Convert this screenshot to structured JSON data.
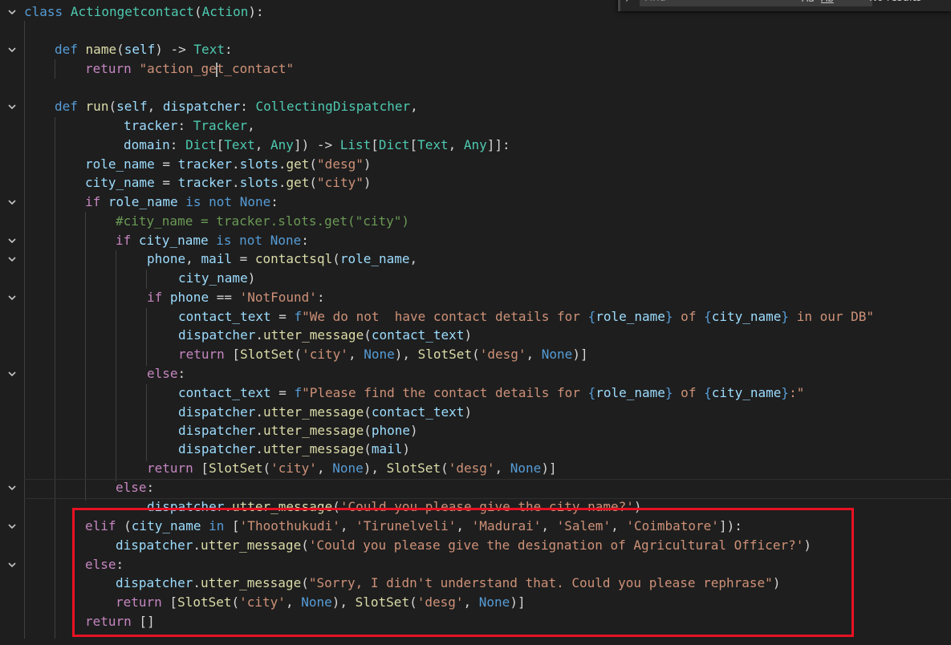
{
  "find_widget": {
    "placeholder": "Find",
    "match_case_label": "Aa",
    "whole_word_label": "Ab",
    "results_text": "No results"
  },
  "code": {
    "l1_class": "class",
    "l1_name": "Actiongetcontact",
    "l1_base": "Action",
    "l3_def": "def",
    "l3_fn": "name",
    "l3_self": "self",
    "l3_ret": "Text",
    "l4_return": "return",
    "l4_str_a": "\"action_ge",
    "l4_str_b": "t_contact\"",
    "l6_def": "def",
    "l6_fn": "run",
    "l6_self": "self",
    "l6_param": "dispatcher",
    "l6_type": "CollectingDispatcher",
    "l7_param": "tracker",
    "l7_type": "Tracker",
    "l8_param": "domain",
    "l8_t1": "Dict",
    "l8_t2": "Text",
    "l8_t3": "Any",
    "l8_t4": "List",
    "l8_t5": "Dict",
    "l8_t6": "Text",
    "l8_t7": "Any",
    "l9_var": "role_name",
    "l9_obj": "tracker",
    "l9_attr": "slots",
    "l9_fn": "get",
    "l9_str": "\"desg\"",
    "l10_var": "city_name",
    "l10_obj": "tracker",
    "l10_attr": "slots",
    "l10_fn": "get",
    "l10_str": "\"city\"",
    "l11_if": "if",
    "l11_var": "role_name",
    "l11_is": "is",
    "l11_not": "not",
    "l11_none": "None",
    "l12_comment": "#city_name = tracker.slots.get(\"city\")",
    "l13_if": "if",
    "l13_var": "city_name",
    "l13_is": "is",
    "l13_not": "not",
    "l13_none": "None",
    "l14_v1": "phone",
    "l14_v2": "mail",
    "l14_fn": "contactsql",
    "l14_arg": "role_name",
    "l15_arg": "city_name",
    "l16_if": "if",
    "l16_var": "phone",
    "l16_str": "'NotFound'",
    "l17_var": "contact_text",
    "l17_f": "f",
    "l17_s1": "\"We do not  have contact details for ",
    "l17_i1": "role_name",
    "l17_s2": " of ",
    "l17_i2": "city_name",
    "l17_s3": " in our DB\"",
    "l18_obj": "dispatcher",
    "l18_fn": "utter_message",
    "l18_arg": "contact_text",
    "l19_return": "return",
    "l19_fn1": "SlotSet",
    "l19_s1": "'city'",
    "l19_n1": "None",
    "l19_fn2": "SlotSet",
    "l19_s2": "'desg'",
    "l19_n2": "None",
    "l20_else": "else",
    "l21_var": "contact_text",
    "l21_f": "f",
    "l21_s1": "\"Please find the contact details for ",
    "l21_i1": "role_name",
    "l21_s2": " of ",
    "l21_i2": "city_name",
    "l21_s3": ":\"",
    "l22_obj": "dispatcher",
    "l22_fn": "utter_message",
    "l22_arg": "contact_text",
    "l23_obj": "dispatcher",
    "l23_fn": "utter_message",
    "l23_arg": "phone",
    "l24_obj": "dispatcher",
    "l24_fn": "utter_message",
    "l24_arg": "mail",
    "l25_return": "return",
    "l25_fn1": "SlotSet",
    "l25_s1": "'city'",
    "l25_n1": "None",
    "l25_fn2": "SlotSet",
    "l25_s2": "'desg'",
    "l25_n2": "None",
    "l26_else": "else",
    "l27_obj": "dispatcher",
    "l27_fn": "utter_message",
    "l27_str": "'Could you please give the city name?'",
    "l28_elif": "elif",
    "l28_var": "city_name",
    "l28_in": "in",
    "l28_s1": "'Thoothukudi'",
    "l28_s2": "'Tirunelveli'",
    "l28_s3": "'Madurai'",
    "l28_s4": "'Salem'",
    "l28_s5": "'Coimbatore'",
    "l29_obj": "dispatcher",
    "l29_fn": "utter_message",
    "l29_str": "'Could you please give the designation of Agricultural Officer?'",
    "l30_else": "else",
    "l31_obj": "dispatcher",
    "l31_fn": "utter_message",
    "l31_str": "\"Sorry, I didn't understand that. Could you please rephrase\"",
    "l32_return": "return",
    "l32_fn1": "SlotSet",
    "l32_s1": "'city'",
    "l32_n1": "None",
    "l32_fn2": "SlotSet",
    "l32_s2": "'desg'",
    "l32_n2": "None",
    "l33_return": "return"
  },
  "colors": {
    "background": "#1e1e1e",
    "keyword": "#569cd6",
    "control": "#c586c0",
    "function": "#dcdcaa",
    "variable": "#9cdcfe",
    "class": "#4ec9b0",
    "string": "#ce9178",
    "comment": "#6a9955",
    "highlight_border": "#e81123"
  }
}
